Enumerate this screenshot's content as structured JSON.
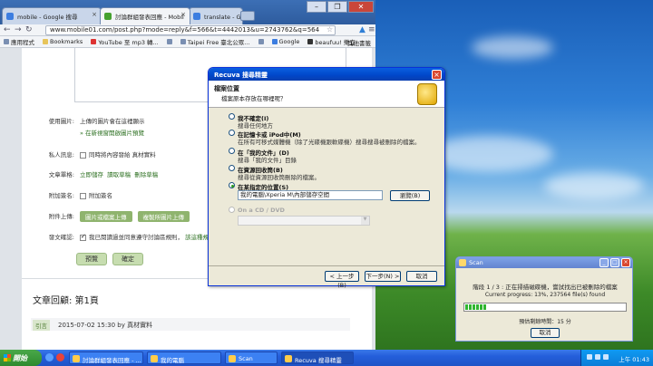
{
  "browser": {
    "tabs": [
      {
        "label": "mobile - Google 搜尋"
      },
      {
        "label": "討論群組發表回應 - Mobil"
      },
      {
        "label": "translate - Google 搜尋"
      }
    ],
    "url": "www.mobile01.com/post.php?mode=reply&f=566&t=4442013&u=2743762&q=564",
    "bookmarks": [
      "應用程式",
      "Bookmarks",
      "YouTube 至 mp3 轉...",
      "",
      "Taipei Free 臺北公眾...",
      "",
      "Google",
      "beaufuu! 樂宜",
      ""
    ],
    "other_bookmarks": "其他書籤"
  },
  "form": {
    "rows": [
      {
        "label": "使用圖片:",
        "value": "上傳的圖片會在這裡顯示"
      },
      {
        "label": "",
        "value": "» 在新視窗開啟圖片預覽"
      },
      {
        "label": "私人訊息:",
        "value": "同時將內容發給 真材實料"
      },
      {
        "label": "文章單格:",
        "links": [
          "立即儲存",
          "讀取草稿",
          "刪除草稿"
        ]
      },
      {
        "label": "附加簽名:",
        "value": "附加簽名"
      },
      {
        "label": "附件上傳:",
        "buttons": [
          "圖片或檔案上傳",
          "複製所圖片上傳"
        ]
      },
      {
        "label": "發文確認:",
        "value": "我已閱讀過並同意遵守討論區規則，",
        "extra": "該這種規劃"
      }
    ],
    "preview_label": "預覽",
    "submit_label": "確定"
  },
  "reply": {
    "heading": "文章回顧: 第1頁",
    "tag": "引言",
    "meta": "2015-07-02 15:30 by 真材實料"
  },
  "recuva": {
    "title": "Recuva 搜尋精靈",
    "header_title": "檔案位置",
    "header_sub": "檔案原本存放在哪裡呢？",
    "options": [
      {
        "title": "我不確定(I)",
        "desc": "搜尋任何地方",
        "selected": false,
        "disabled": false
      },
      {
        "title": "在記憶卡或 iPod中(M)",
        "desc": "在所有可移式媒體機（除了光碟機跟軟碟機）搜尋搜尋被刪除的檔案。",
        "selected": false,
        "disabled": false
      },
      {
        "title": "在「我的文件」(D)",
        "desc": "搜尋「我的文件」目錄",
        "selected": false,
        "disabled": false
      },
      {
        "title": "在資源回收筒(B)",
        "desc": "搜尋從資源回收筒刪除的檔案。",
        "selected": false,
        "disabled": false
      },
      {
        "title": "在某指定的位置(S)",
        "desc": "",
        "selected": true,
        "disabled": false
      },
      {
        "title": "On a CD / DVD",
        "desc": "",
        "selected": false,
        "disabled": true
      }
    ],
    "path_value": "我的電腦\\Xperia M\\內部儲存空間",
    "browse_label": "瀏覽(B)",
    "back_label": "< 上一步(B)",
    "next_label": "下一步(N) >",
    "cancel_label": "取消"
  },
  "scan": {
    "title": "Scan",
    "stage": "階段 1 / 3 : 正在掃描磁碟機，嘗試找出已被刪除的檔案",
    "progress_text": "Current progress: 13%, 237564 file(s) found",
    "progress": 0.13,
    "remaining": "預估剩餘時間：15 分",
    "cancel": "取消"
  },
  "taskbar": {
    "start": "開始",
    "items": [
      "討論群組發表回應 - ...",
      "我的電腦",
      "Scan",
      "Recuva 搜尋精靈"
    ],
    "clock": "上午 01:43"
  }
}
